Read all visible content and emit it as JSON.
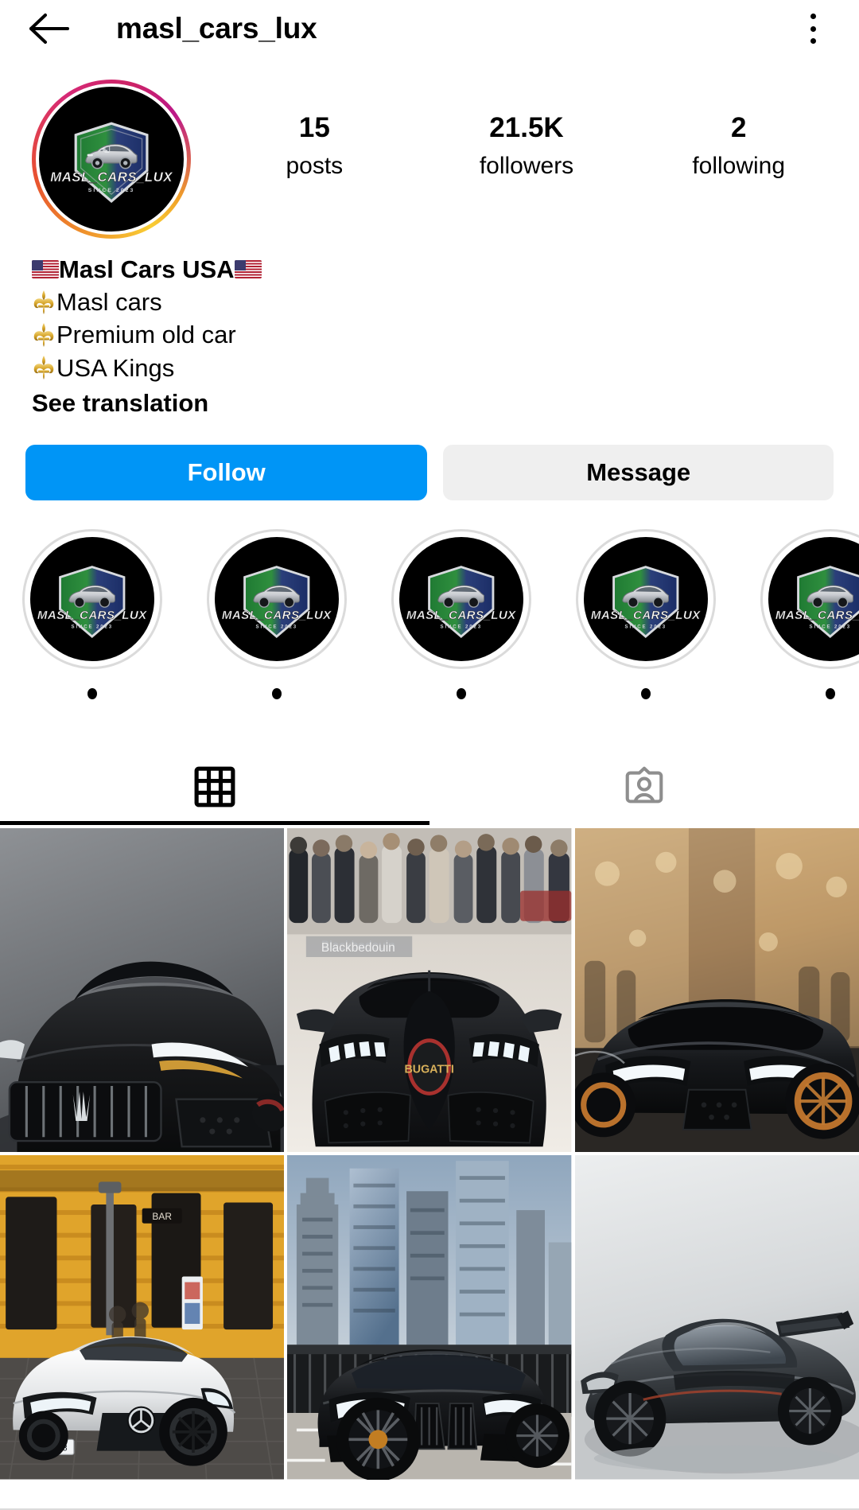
{
  "topbar": {
    "back_icon": "arrow-left-icon",
    "title": "masl_cars_lux",
    "menu_icon": "kebab-menu-icon"
  },
  "profile": {
    "avatar_label": "masl_cars_lux profile picture",
    "logo_text": "MASL_CARS_LUX",
    "logo_sub": "SINCE 2023",
    "has_story_ring": true,
    "stats": [
      {
        "value": "15",
        "label": "posts"
      },
      {
        "value": "21.5K",
        "label": "followers"
      },
      {
        "value": "2",
        "label": "following"
      }
    ],
    "bio": [
      {
        "prefix_icon": "us-flag-emoji",
        "text": "Masl Cars USA",
        "suffix_icon": "us-flag-emoji",
        "bold": true
      },
      {
        "prefix_icon": "fleur-de-lis-emoji",
        "text": "Masl cars",
        "bold": false
      },
      {
        "prefix_icon": "fleur-de-lis-emoji",
        "text": "Premium old car",
        "bold": false
      },
      {
        "prefix_icon": "fleur-de-lis-emoji",
        "text": "USA Kings",
        "bold": false
      }
    ],
    "see_translation": "See translation"
  },
  "actions": {
    "follow_label": "Follow",
    "message_label": "Message",
    "follow_color": "#0095f6",
    "message_color": "#efefef"
  },
  "highlights": [
    {
      "label": "•"
    },
    {
      "label": "•"
    },
    {
      "label": "•"
    },
    {
      "label": "•"
    },
    {
      "label": "•"
    }
  ],
  "tabs": [
    {
      "icon": "grid-icon",
      "name": "posts-tab",
      "active": true
    },
    {
      "icon": "tagged-icon",
      "name": "tagged-tab",
      "active": false
    }
  ],
  "posts": [
    {
      "alt": "Black Maserati Ghibli front view on gray background",
      "watermark": ""
    },
    {
      "alt": "Matte black Bugatti Chiron at auto show with crowd",
      "watermark": "Blackbedouin"
    },
    {
      "alt": "Black Mercedes-AMG GT on a city street",
      "watermark": ""
    },
    {
      "alt": "White Mercedes-AMG C63 coupe by yellow building",
      "watermark": ""
    },
    {
      "alt": "Black BMW M8 coupe with Los Angeles skyline",
      "watermark": ""
    },
    {
      "alt": "Gray McLaren P1 supercar in studio",
      "watermark": ""
    }
  ],
  "colors": {
    "accent_blue": "#0095f6",
    "light_gray": "#efefef",
    "border_gray": "#dbdbdb",
    "text_black": "#000000",
    "inactive_gray": "#8e8e8e"
  }
}
